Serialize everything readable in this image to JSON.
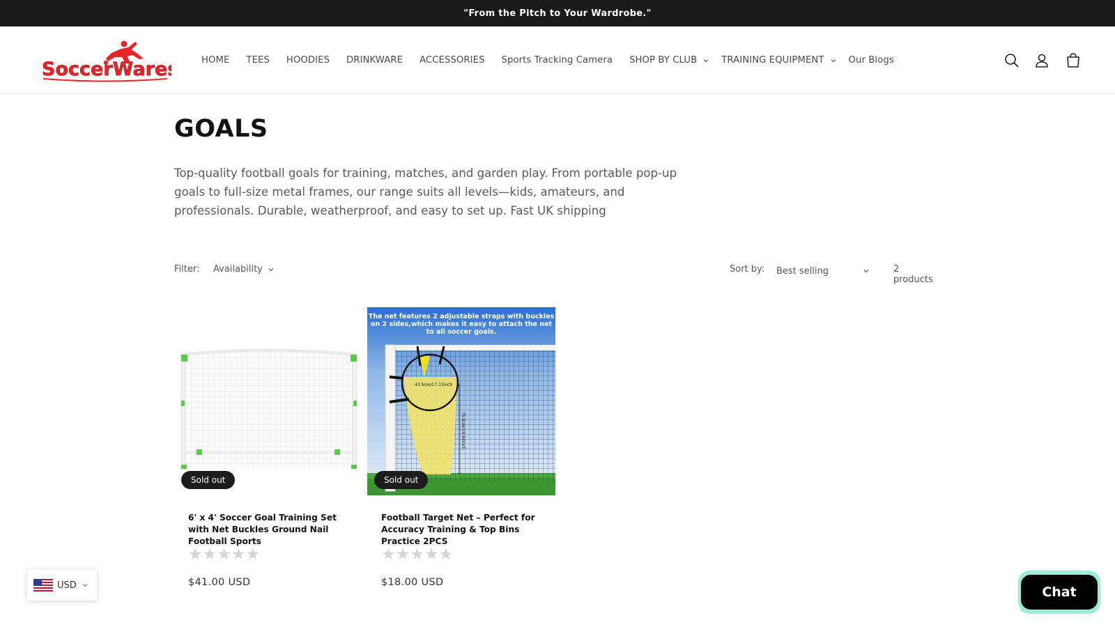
{
  "announcement": "\"From the Pitch to Your Wardrobe.\"",
  "brand": {
    "logo_text": "SoccerWares",
    "accent": "#e8262a"
  },
  "nav": {
    "items": [
      {
        "label": "HOME",
        "dropdown": false
      },
      {
        "label": "TEES",
        "dropdown": false
      },
      {
        "label": "HOODIES",
        "dropdown": false
      },
      {
        "label": "DRINKWARE",
        "dropdown": false
      },
      {
        "label": "ACCESSORIES",
        "dropdown": false
      },
      {
        "label": "Sports Tracking Camera",
        "dropdown": false
      },
      {
        "label": "SHOP BY CLUB",
        "dropdown": true
      },
      {
        "label": "TRAINING EQUIPMENT",
        "dropdown": true
      },
      {
        "label": "Our Blogs",
        "dropdown": false
      }
    ]
  },
  "header_icons": [
    "search-icon",
    "account-icon",
    "cart-icon"
  ],
  "collection": {
    "title": "GOALS",
    "description": "Top-quality football goals for training, matches, and garden play. From portable pop-up goals to full-size metal frames, our range suits all levels—kids, amateurs, and professionals. Durable, weatherproof, and easy to set up. Fast UK shipping"
  },
  "filters": {
    "filter_label": "Filter:",
    "availability_label": "Availability",
    "sort_label": "Sort by:",
    "sort_value": "Best selling",
    "product_count": "2 products"
  },
  "products": [
    {
      "title": "6' x 4' Soccer Goal Training Set with Net Buckles Ground Nail Football Sports",
      "badge": "Sold out",
      "price": "$41.00 USD",
      "rating_stars": "★★★★★"
    },
    {
      "title": "Football Target Net – Perfect for Accuracy Training & Top Bins Practice 2PCS",
      "badge": "Sold out",
      "price": "$18.00 USD",
      "rating_stars": "★★★★★",
      "image_caption": "The net features 2 adjustable straps with buckles on 2 sides,which makes it easy to attach the net to all soccer goals.",
      "image_dim_1": "43.5cm/17.13inch",
      "image_dim_2": "75.8cm/29.84inch"
    }
  ],
  "currency": {
    "code": "USD"
  },
  "chat": {
    "label": "Chat"
  }
}
